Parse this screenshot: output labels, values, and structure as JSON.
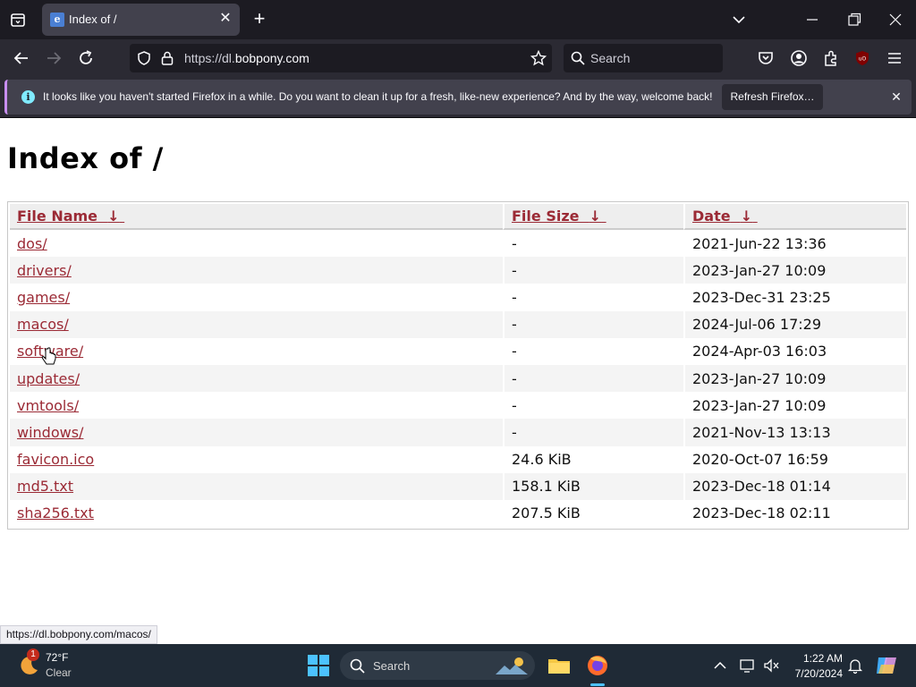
{
  "browser": {
    "tab_title": "Index of /",
    "url_prefix": "https://dl.",
    "url_host": "bobpony.com",
    "search_placeholder": "Search",
    "notification": {
      "message": "It looks like you haven't started Firefox in a while. Do you want to clean it up for a fresh, like-new experience? And by the way, welcome back!",
      "button_label": "Refresh Firefox…"
    },
    "status_url": "https://dl.bobpony.com/macos/"
  },
  "page": {
    "title": "Index of /",
    "columns": [
      {
        "label": "File Name",
        "sort": "↓"
      },
      {
        "label": "File Size",
        "sort": "↓"
      },
      {
        "label": "Date",
        "sort": "↓"
      }
    ],
    "rows": [
      {
        "name": "dos/",
        "size": "-",
        "date": "2021-Jun-22 13:36"
      },
      {
        "name": "drivers/",
        "size": "-",
        "date": "2023-Jan-27 10:09"
      },
      {
        "name": "games/",
        "size": "-",
        "date": "2023-Dec-31 23:25"
      },
      {
        "name": "macos/",
        "size": "-",
        "date": "2024-Jul-06 17:29"
      },
      {
        "name": "software/",
        "size": "-",
        "date": "2024-Apr-03 16:03"
      },
      {
        "name": "updates/",
        "size": "-",
        "date": "2023-Jan-27 10:09"
      },
      {
        "name": "vmtools/",
        "size": "-",
        "date": "2023-Jan-27 10:09"
      },
      {
        "name": "windows/",
        "size": "-",
        "date": "2021-Nov-13 13:13"
      },
      {
        "name": "favicon.ico",
        "size": "24.6 KiB",
        "date": "2020-Oct-07 16:59"
      },
      {
        "name": "md5.txt",
        "size": "158.1 KiB",
        "date": "2023-Dec-18 01:14"
      },
      {
        "name": "sha256.txt",
        "size": "207.5 KiB",
        "date": "2023-Dec-18 02:11"
      }
    ]
  },
  "taskbar": {
    "weather_temp": "72°F",
    "weather_condition": "Clear",
    "weather_badge": "1",
    "search_label": "Search",
    "time": "1:22 AM",
    "date": "7/20/2024"
  },
  "colors": {
    "link": "#9b2a35",
    "accent": "#c88ef0",
    "taskbar": "#1f2a36"
  },
  "icons": [
    "tab-list-icon",
    "ie-favicon-icon",
    "close-icon",
    "plus-icon",
    "chevron-down-icon",
    "minimize-icon",
    "restore-icon",
    "back-icon",
    "forward-icon",
    "reload-icon",
    "shield-icon",
    "lock-icon",
    "star-icon",
    "search-icon",
    "pocket-icon",
    "account-icon",
    "extensions-icon",
    "ublock-icon",
    "menu-icon",
    "info-icon",
    "weather-icon",
    "windows-start-icon",
    "file-explorer-icon",
    "firefox-icon",
    "chevron-up-icon",
    "network-icon",
    "bluetooth-icon",
    "bell-icon",
    "copilot-icon"
  ]
}
